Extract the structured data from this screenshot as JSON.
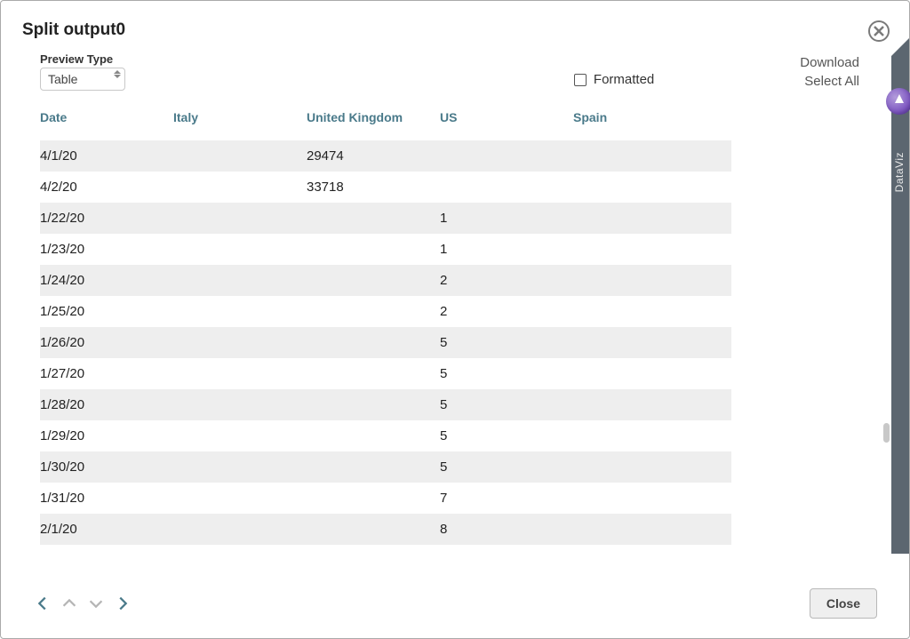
{
  "title": "Split output0",
  "preview": {
    "label": "Preview Type",
    "value": "Table"
  },
  "formatted": {
    "label": "Formatted",
    "checked": false
  },
  "links": {
    "download": "Download",
    "select_all": "Select All"
  },
  "sidetab": {
    "label": "DataViz"
  },
  "footer": {
    "close": "Close"
  },
  "table": {
    "columns": [
      "Date",
      "Italy",
      "United Kingdom",
      "US",
      "Spain"
    ],
    "rows": [
      {
        "date": "4/1/20",
        "italy": "",
        "uk": "29474",
        "us": "",
        "spain": ""
      },
      {
        "date": "4/2/20",
        "italy": "",
        "uk": "33718",
        "us": "",
        "spain": ""
      },
      {
        "date": "1/22/20",
        "italy": "",
        "uk": "",
        "us": "1",
        "spain": ""
      },
      {
        "date": "1/23/20",
        "italy": "",
        "uk": "",
        "us": "1",
        "spain": ""
      },
      {
        "date": "1/24/20",
        "italy": "",
        "uk": "",
        "us": "2",
        "spain": ""
      },
      {
        "date": "1/25/20",
        "italy": "",
        "uk": "",
        "us": "2",
        "spain": ""
      },
      {
        "date": "1/26/20",
        "italy": "",
        "uk": "",
        "us": "5",
        "spain": ""
      },
      {
        "date": "1/27/20",
        "italy": "",
        "uk": "",
        "us": "5",
        "spain": ""
      },
      {
        "date": "1/28/20",
        "italy": "",
        "uk": "",
        "us": "5",
        "spain": ""
      },
      {
        "date": "1/29/20",
        "italy": "",
        "uk": "",
        "us": "5",
        "spain": ""
      },
      {
        "date": "1/30/20",
        "italy": "",
        "uk": "",
        "us": "5",
        "spain": ""
      },
      {
        "date": "1/31/20",
        "italy": "",
        "uk": "",
        "us": "7",
        "spain": ""
      },
      {
        "date": "2/1/20",
        "italy": "",
        "uk": "",
        "us": "8",
        "spain": ""
      }
    ]
  }
}
